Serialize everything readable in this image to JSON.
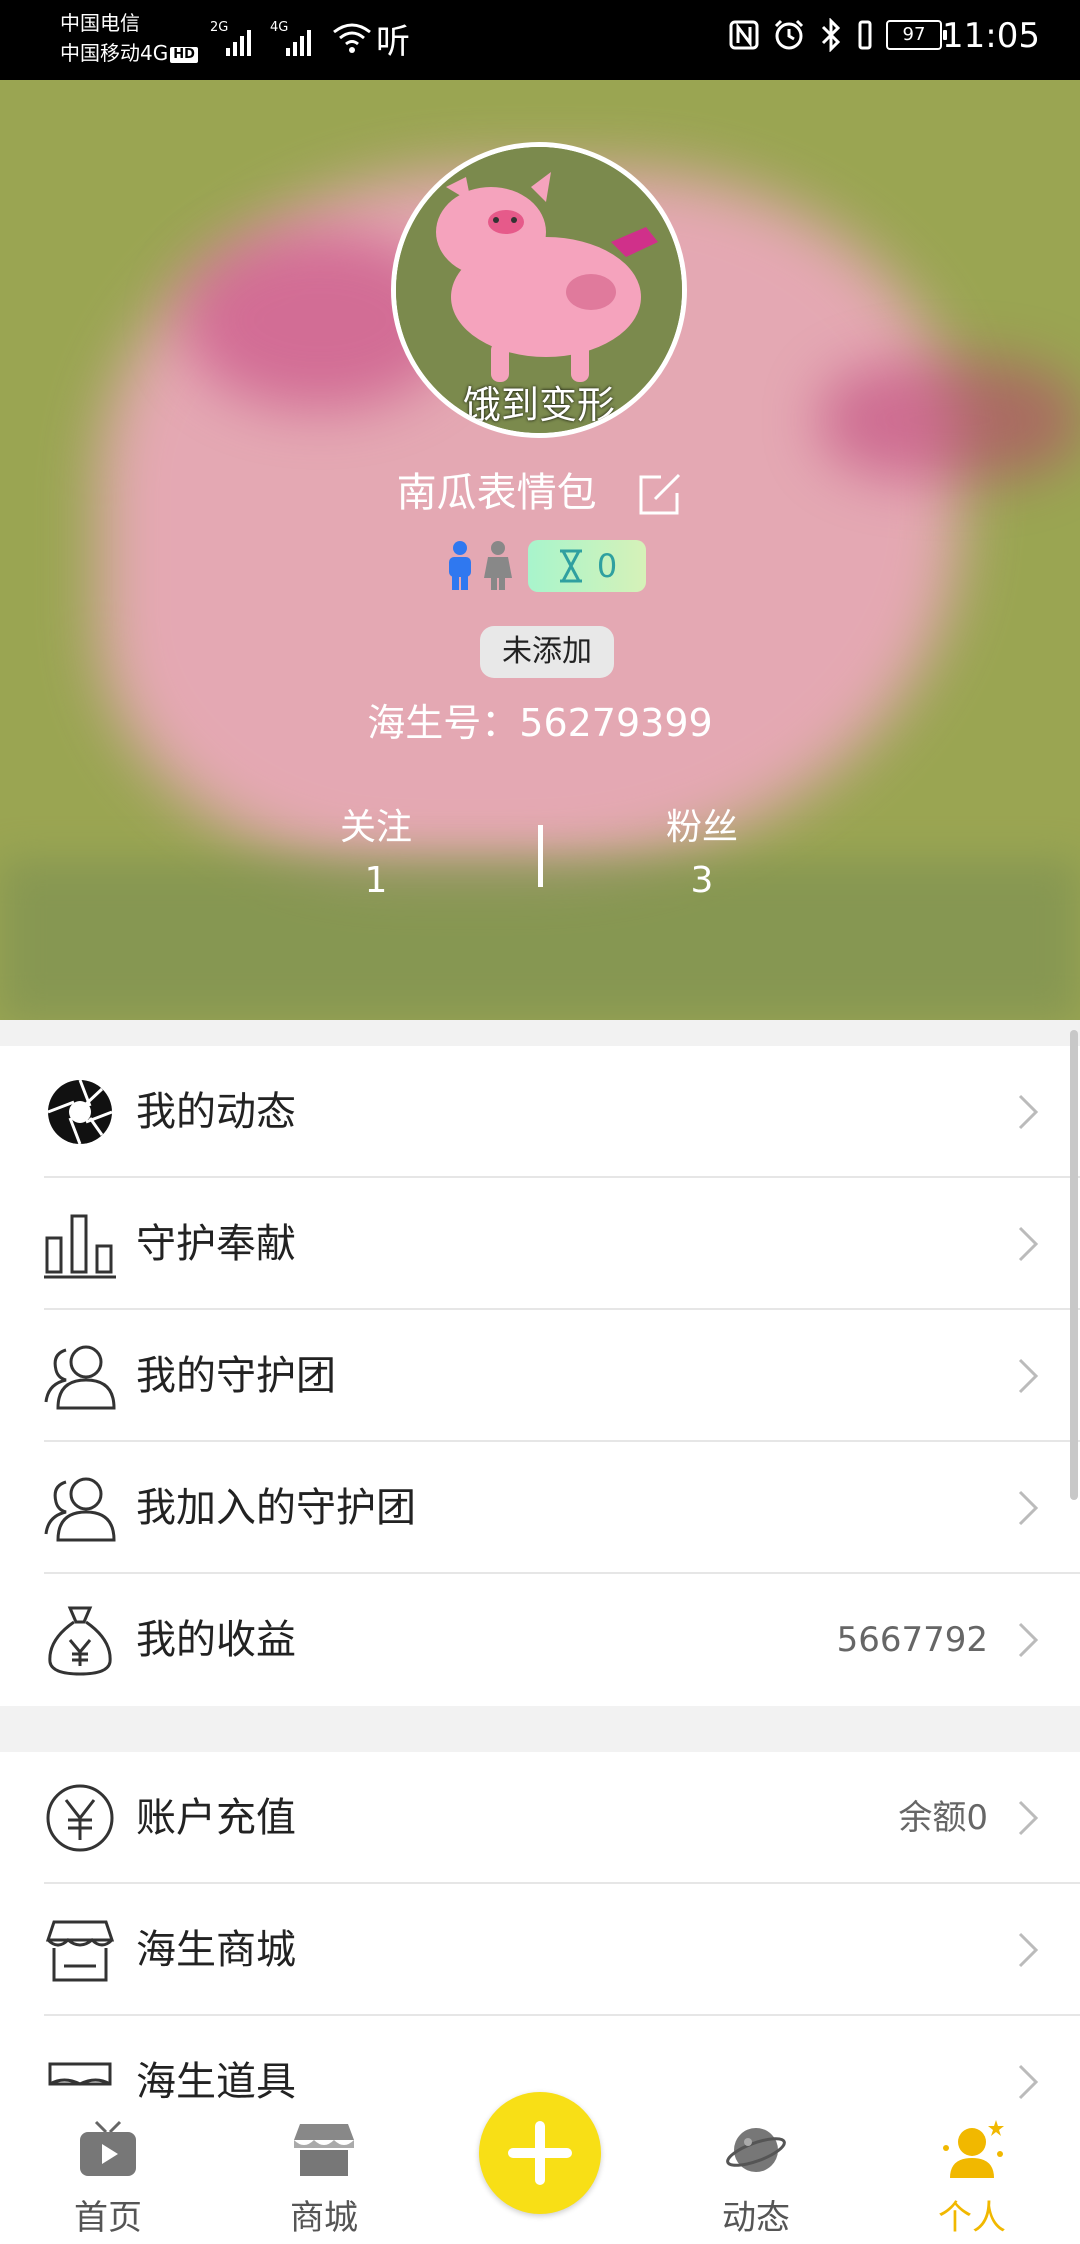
{
  "status_bar": {
    "carrier1": "中国电信",
    "carrier2": "中国移动4G",
    "hd": "HD",
    "net1": "2G",
    "net2": "4G",
    "ting": "听",
    "battery": "97",
    "time": "11:05"
  },
  "profile": {
    "avatar_caption": "饿到变形",
    "username": "南瓜表情包",
    "level": "0",
    "tag": "未添加",
    "uid": "海生号：56279399",
    "follow_label": "关注",
    "follow_count": "1",
    "fans_label": "粉丝",
    "fans_count": "3"
  },
  "menu_group1": [
    {
      "label": "我的动态",
      "value": "",
      "icon": "camera-aperture-icon"
    },
    {
      "label": "守护奉献",
      "value": "",
      "icon": "bar-chart-icon"
    },
    {
      "label": "我的守护团",
      "value": "",
      "icon": "users-icon"
    },
    {
      "label": "我加入的守护团",
      "value": "",
      "icon": "users-icon"
    },
    {
      "label": "我的收益",
      "value": "5667792",
      "icon": "money-bag-icon"
    }
  ],
  "menu_group2": [
    {
      "label": "账户充值",
      "value": "余额0",
      "icon": "yen-circle-icon"
    },
    {
      "label": "海生商城",
      "value": "",
      "icon": "store-icon"
    },
    {
      "label": "海生道具",
      "value": "",
      "icon": "props-icon"
    }
  ],
  "bottom_nav": {
    "home": "首页",
    "mall": "商城",
    "dynamic": "动态",
    "me": "个人"
  },
  "colors": {
    "accent": "#f1b800",
    "fab": "#f8df16"
  }
}
